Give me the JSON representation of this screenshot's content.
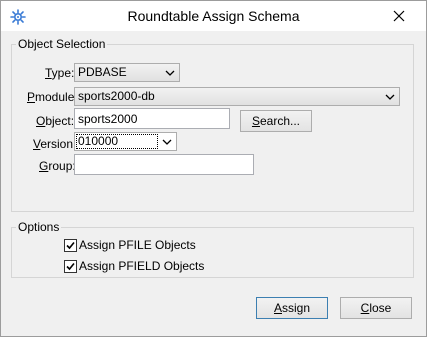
{
  "window": {
    "title": "Roundtable Assign Schema",
    "app_icon": "gear-network-icon",
    "close_icon": "close-icon"
  },
  "object_selection": {
    "legend": "Object Selection",
    "type": {
      "label_accel": "T",
      "label_rest": "ype:",
      "value": "PDBASE"
    },
    "pmodule": {
      "label_accel": "P",
      "label_rest": "module:",
      "value": "sports2000-db"
    },
    "object": {
      "label_accel": "O",
      "label_rest": "bject:",
      "value": "sports2000"
    },
    "search_button": {
      "accel": "S",
      "rest": "earch..."
    },
    "version": {
      "label_accel": "V",
      "label_rest": "ersion:",
      "value": "010000"
    },
    "group": {
      "label_accel": "G",
      "label_rest": "roup:",
      "value": ""
    }
  },
  "options": {
    "legend": "Options",
    "pfile": {
      "label": "Assign PFILE Objects",
      "checked": true
    },
    "pfield": {
      "label": "Assign PFIELD Objects",
      "checked": true
    }
  },
  "buttons": {
    "assign": {
      "accel": "A",
      "rest": "ssign"
    },
    "close": {
      "accel": "C",
      "rest": "lose"
    }
  }
}
